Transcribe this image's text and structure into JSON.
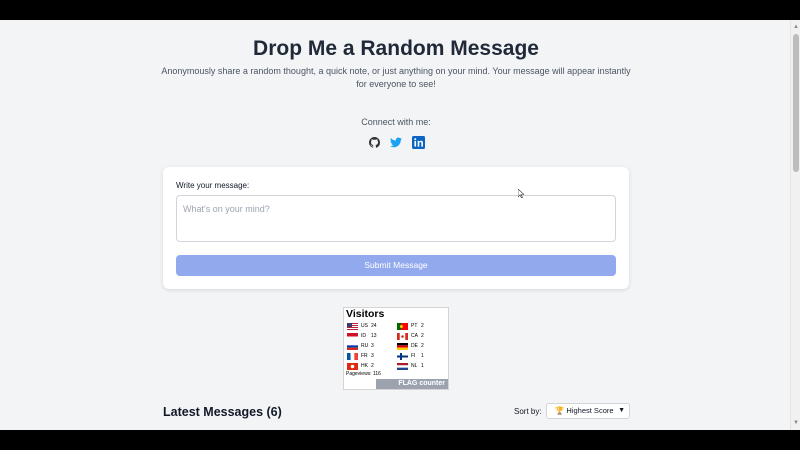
{
  "page": {
    "title": "Drop Me a Random Message",
    "subtitle": "Anonymously share a random thought, a quick note, or just anything on your mind. Your message will appear instantly for everyone to see!",
    "connect_label": "Connect with me:"
  },
  "socials": [
    {
      "icon": "github-icon",
      "color": "#333333"
    },
    {
      "icon": "twitter-icon",
      "color": "#1da1f2"
    },
    {
      "icon": "linkedin-icon",
      "color": "#0a66c2"
    }
  ],
  "form": {
    "label": "Write your message:",
    "placeholder": "What's on your mind?",
    "submit_label": "Submit Message"
  },
  "flag_counter": {
    "title": "Visitors",
    "left": [
      {
        "code": "US",
        "count": "24"
      },
      {
        "code": "ID",
        "count": "13"
      },
      {
        "code": "RU",
        "count": "3"
      },
      {
        "code": "FR",
        "count": "3"
      },
      {
        "code": "HK",
        "count": "2"
      }
    ],
    "right": [
      {
        "code": "PT",
        "count": "2"
      },
      {
        "code": "CA",
        "count": "2"
      },
      {
        "code": "DE",
        "count": "2"
      },
      {
        "code": "FI",
        "count": "1"
      },
      {
        "code": "NL",
        "count": "1"
      }
    ],
    "pageviews_label": "Pageviews:",
    "pageviews": "116",
    "logo": "FLAG counter"
  },
  "messages": {
    "heading": "Latest Messages (6)",
    "sort_label": "Sort by:",
    "sort_value": "🏆 Highest Score"
  },
  "colors": {
    "accent_disabled": "#93a9ee",
    "background": "#f3f4f6"
  }
}
